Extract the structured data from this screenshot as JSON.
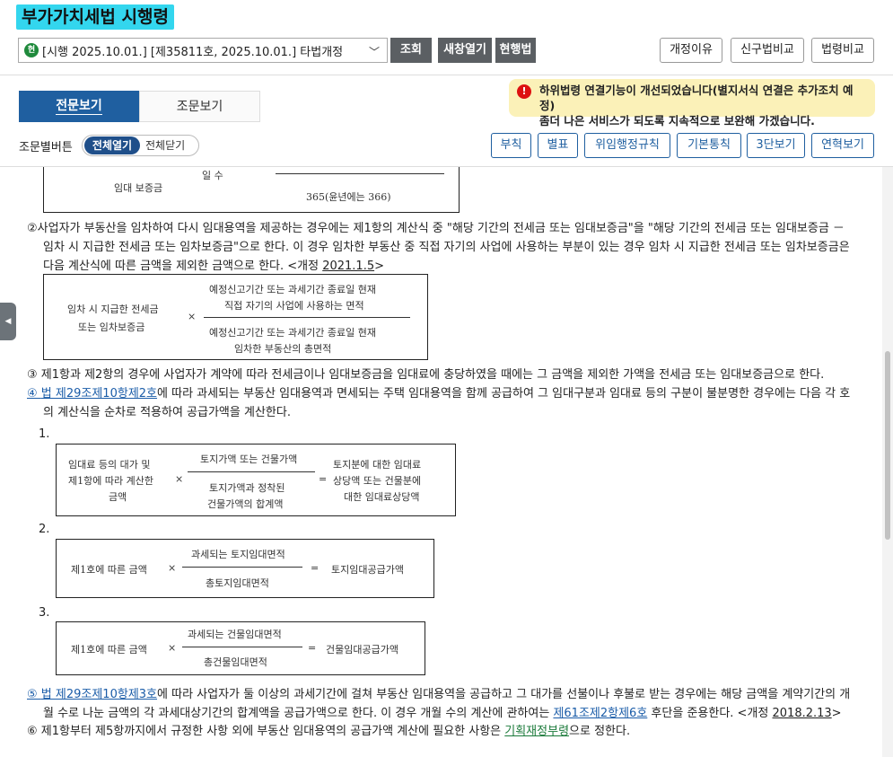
{
  "header": {
    "title": "부가가치세법 시행령"
  },
  "toolbar": {
    "select_icon": "현",
    "select_value": "[시행 2025.10.01.] [제35811호, 2025.10.01.] 타법개정",
    "search_btn": "조회",
    "newwin_btn": "새창열기",
    "current_btn": "현행법",
    "reason_btn": "개정이유",
    "compare_btn": "신구법비교",
    "lawcmp_btn": "법령비교"
  },
  "tabs": {
    "full": "전문보기",
    "article": "조문보기"
  },
  "notice": {
    "line1": "하위법령 연결기능이 개선되었습니다(별지서식 연결은 추가조치 예정)",
    "line2": "좀더 나은 서비스가 되도록 지속적으로 보완해 가겠습니다."
  },
  "controls": {
    "label": "조문별버튼",
    "open_all": "전체열기",
    "close_all": "전체닫기",
    "buttons": [
      "부칙",
      "별표",
      "위임행정규칙",
      "기본통칙",
      "3단보기",
      "연혁보기"
    ]
  },
  "box0": {
    "left": "임대 보증금",
    "mid": "일 수",
    "den": "365(윤년에는 366)"
  },
  "p2": {
    "line1": "②사업자가 부동산을 임차하여 다시 임대용역을 제공하는 경우에는 제1항의 계산식 중 \"해당 기간의 전세금 또는 임대보증금\"을 \"해당 기간의 전세금 또는 임대보증금 －",
    "line2": "임차 시 지급한 전세금 또는 임차보증금\"으로 한다. 이 경우 임차한 부동산 중 직접 자기의 사업에 사용하는 부분이 있는 경우 임차 시 지급한 전세금 또는 임차보증금은",
    "line3a": "다음 계산식에 따른 금액을 제외한 금액으로 한다. <개정 ",
    "date": "2021.1.5",
    "line3b": ">"
  },
  "box1": {
    "left1": "임차 시 지급한 전세금",
    "left2": "또는 임차보증금",
    "x": "×",
    "num1": "예정신고기간 또는 과세기간 종료일 현재",
    "num2": "직접 자기의 사업에 사용하는 면적",
    "den1": "예정신고기간 또는 과세기간 종료일 현재",
    "den2": "임차한 부동산의 총면적"
  },
  "p3": {
    "text": "③ 제1항과 제2항의 경우에 사업자가 계약에 따라 전세금이나 임대보증금을 임대료에 충당하였을 때에는 그 금액을 제외한 가액을 전세금 또는 임대보증금으로 한다."
  },
  "p4": {
    "mark": "④ ",
    "link": "법 제29조제10항제2호",
    "line1": "에 따라 과세되는 부동산 임대용역과 면세되는 주택 임대용역을 함께 공급하여 그 임대구분과 임대료 등의 구분이 불분명한 경우에는 다음 각 호",
    "line2": "의 계산식을 순차로 적용하여 공급가액을 계산한다."
  },
  "item1": {
    "num": "1.",
    "l1": "임대료 등의 대가 및",
    "l2": "제1항에 따라 계산한",
    "l3": "금액",
    "x": "×",
    "num_text": "토지가액 또는 건물가액",
    "den1": "토지가액과 정착된",
    "den2": "건물가액의 합계액",
    "eq": "=",
    "r1": "토지분에 대한 임대료",
    "r2": "상당액 또는 건물분에",
    "r3": "대한 임대료상당액"
  },
  "item2": {
    "num": "2.",
    "left": "제1호에 따른 금액",
    "x": "×",
    "num_text": "과세되는 토지임대면적",
    "den": "총토지임대면적",
    "eq": "=",
    "right": "토지임대공급가액"
  },
  "item3": {
    "num": "3.",
    "left": "제1호에 따른 금액",
    "x": "×",
    "num_text": "과세되는 건물임대면적",
    "den": "총건물임대면적",
    "eq": "=",
    "right": "건물임대공급가액"
  },
  "p5": {
    "mark": "⑤ ",
    "link": "법 제29조제10항제3호",
    "line1": "에 따라 사업자가 둘 이상의 과세기간에 걸쳐 부동산 임대용역을 공급하고 그 대가를 선불이나 후불로 받는 경우에는 해당 금액을 계약기간의 개",
    "line2a": "월 수로 나눈 금액의 각 과세대상기간의 합계액을 공급가액으로 한다. 이 경우 개월 수의 계산에 관하여는 ",
    "link2": "제61조제2항제6호",
    "line2b": " 후단을 준용한다. <개정 ",
    "date": "2018.2.13",
    "line2c": ">"
  },
  "p6": {
    "a": "⑥ 제1항부터 제5항까지에서 규정한 사항 외에 부동산 임대용역의 공급가액 계산에 필요한 사항은 ",
    "link": "기획재정부령",
    "b": "으로 정한다."
  },
  "colors": {
    "accent": "#1f5fa0",
    "highlight": "#33d6ee",
    "notice_bg": "#fbf1b8",
    "link": "#1a5ca8"
  }
}
